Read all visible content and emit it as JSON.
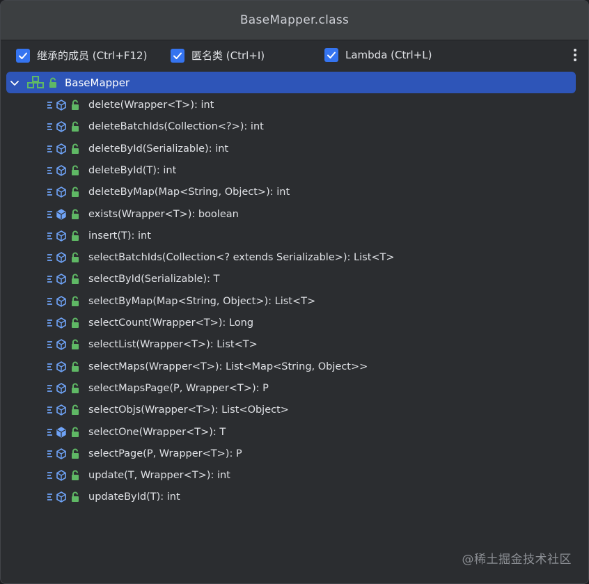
{
  "window": {
    "title": "BaseMapper.class"
  },
  "options": [
    {
      "label": "继承的成员 (Ctrl+F12)",
      "checked": true
    },
    {
      "label": "匿名类 (Ctrl+I)",
      "checked": true
    },
    {
      "label": "Lambda (Ctrl+L)",
      "checked": true
    }
  ],
  "root": {
    "label": "BaseMapper",
    "expanded": true
  },
  "methods": [
    {
      "label": "delete(Wrapper<T>): int",
      "icon": "abstract-method-icon"
    },
    {
      "label": "deleteBatchIds(Collection<?>): int",
      "icon": "abstract-method-icon"
    },
    {
      "label": "deleteById(Serializable): int",
      "icon": "abstract-method-icon"
    },
    {
      "label": "deleteById(T): int",
      "icon": "abstract-method-icon"
    },
    {
      "label": "deleteByMap(Map<String, Object>): int",
      "icon": "abstract-method-icon"
    },
    {
      "label": "exists(Wrapper<T>): boolean",
      "icon": "default-method-icon"
    },
    {
      "label": "insert(T): int",
      "icon": "abstract-method-icon"
    },
    {
      "label": "selectBatchIds(Collection<? extends Serializable>): List<T>",
      "icon": "abstract-method-icon"
    },
    {
      "label": "selectById(Serializable): T",
      "icon": "abstract-method-icon"
    },
    {
      "label": "selectByMap(Map<String, Object>): List<T>",
      "icon": "abstract-method-icon"
    },
    {
      "label": "selectCount(Wrapper<T>): Long",
      "icon": "abstract-method-icon"
    },
    {
      "label": "selectList(Wrapper<T>): List<T>",
      "icon": "abstract-method-icon"
    },
    {
      "label": "selectMaps(Wrapper<T>): List<Map<String, Object>>",
      "icon": "abstract-method-icon"
    },
    {
      "label": "selectMapsPage(P, Wrapper<T>): P",
      "icon": "abstract-method-icon"
    },
    {
      "label": "selectObjs(Wrapper<T>): List<Object>",
      "icon": "abstract-method-icon"
    },
    {
      "label": "selectOne(Wrapper<T>): T",
      "icon": "default-method-icon"
    },
    {
      "label": "selectPage(P, Wrapper<T>): P",
      "icon": "abstract-method-icon"
    },
    {
      "label": "update(T, Wrapper<T>): int",
      "icon": "abstract-method-icon"
    },
    {
      "label": "updateById(T): int",
      "icon": "abstract-method-icon"
    }
  ],
  "colors": {
    "accent": "#3574f0",
    "selection": "#2e55b8",
    "icon_blue": "#6fa3f7",
    "lock_green": "#5fb865"
  },
  "watermark": "@稀土掘金技术社区"
}
